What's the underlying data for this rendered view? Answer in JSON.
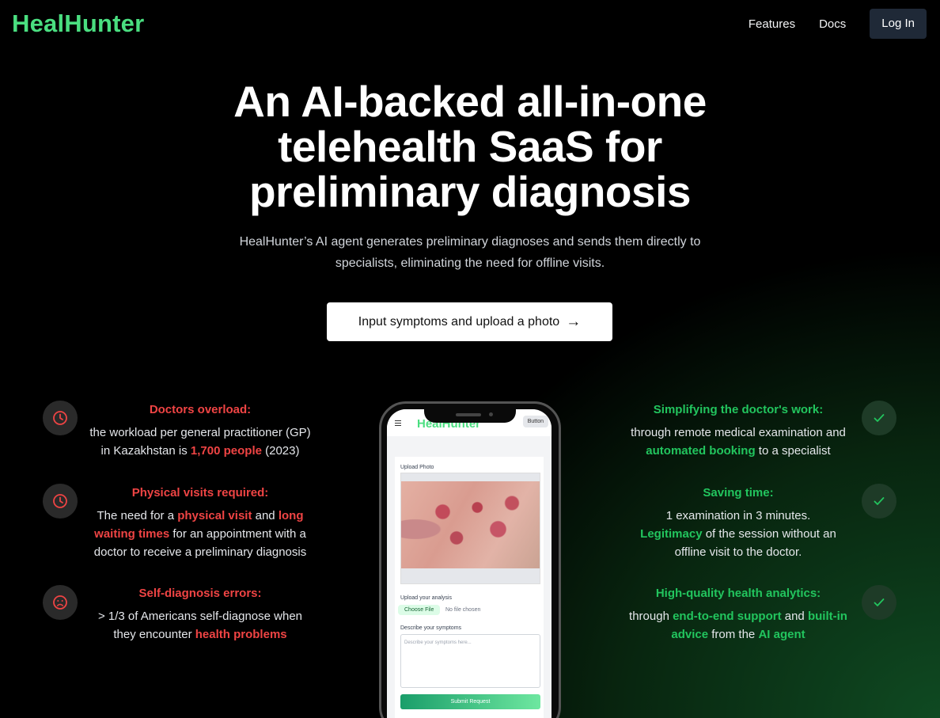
{
  "nav": {
    "logo": "HealHunter",
    "links": [
      "Features",
      "Docs"
    ],
    "login": "Log In"
  },
  "hero": {
    "title_lines": [
      "An AI-backed all-in-one",
      "telehealth SaaS for",
      "preliminary diagnosis"
    ],
    "subtitle_lines": [
      "HealHunter’s AI agent generates preliminary diagnoses and sends them directly to",
      "specialists, eliminating the need for offline visits."
    ],
    "cta": "Input symptoms and upload a photo",
    "cta_arrow": "→"
  },
  "problems": [
    {
      "icon": "clock-icon",
      "title": "Doctors overload:",
      "lines": [
        [
          "the workload per general practitioner (GP)"
        ],
        [
          "in Kazakhstan is ",
          {
            "hl": "1,700 people"
          },
          " (2023)"
        ]
      ]
    },
    {
      "icon": "clock-icon",
      "title": "Physical visits required:",
      "lines": [
        [
          "The need for a ",
          {
            "hl": "physical visit"
          },
          " and ",
          {
            "hl": "long"
          }
        ],
        [
          {
            "hl": "waiting times"
          },
          " for an appointment with a"
        ],
        [
          "doctor to receive a preliminary diagnosis"
        ]
      ]
    },
    {
      "icon": "sad-face-icon",
      "title": "Self-diagnosis errors:",
      "lines": [
        [
          "> 1/3 of Americans self-diagnose when"
        ],
        [
          "they encounter ",
          {
            "hl": "health problems"
          }
        ]
      ]
    }
  ],
  "benefits": [
    {
      "icon": "check-icon",
      "title": "Simplifying the doctor's work:",
      "lines": [
        [
          "through remote medical examination and"
        ],
        [
          {
            "hl": "automated booking"
          },
          " to a specialist"
        ]
      ]
    },
    {
      "icon": "check-icon",
      "title": "Saving time:",
      "lines": [
        [
          "1 examination in 3 minutes."
        ],
        [
          {
            "hl": "Legitimacy"
          },
          " of the session without an"
        ],
        [
          "offline visit to the doctor."
        ]
      ]
    },
    {
      "icon": "check-icon",
      "title": "High-quality health analytics:",
      "lines": [
        [
          "through ",
          {
            "hl": "end-to-end support"
          },
          " and ",
          {
            "hl": "built-in"
          }
        ],
        [
          {
            "hl": "advice"
          },
          " from the ",
          {
            "hl": "AI agent"
          }
        ]
      ]
    }
  ],
  "phone": {
    "logo": "HealHunter",
    "header_button": "Button",
    "upload_photo_label": "Upload Photo",
    "upload_analysis_label": "Upload your analysis",
    "choose_file": "Choose File",
    "no_file": "No file chosen",
    "describe_label": "Describe your symptoms",
    "describe_placeholder": "Describe your symptoms here...",
    "submit": "Submit Request"
  },
  "colors": {
    "accent_green": "#4ade80",
    "highlight_green": "#22c55e",
    "highlight_red": "#ef4444"
  }
}
